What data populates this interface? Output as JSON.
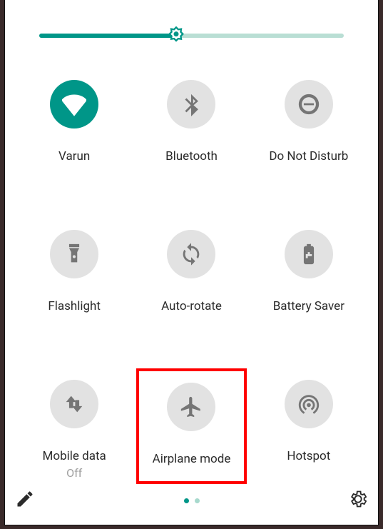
{
  "brightness": {
    "percent": 45
  },
  "tiles": [
    {
      "label": "Varun",
      "sublabel": ""
    },
    {
      "label": "Bluetooth",
      "sublabel": ""
    },
    {
      "label": "Do Not Disturb",
      "sublabel": ""
    },
    {
      "label": "Flashlight",
      "sublabel": ""
    },
    {
      "label": "Auto-rotate",
      "sublabel": ""
    },
    {
      "label": "Battery Saver",
      "sublabel": ""
    },
    {
      "label": "Mobile data",
      "sublabel": "Off"
    },
    {
      "label": "Airplane mode",
      "sublabel": ""
    },
    {
      "label": "Hotspot",
      "sublabel": ""
    }
  ],
  "pagination": {
    "current": 1,
    "total": 2
  },
  "colors": {
    "accent": "#009688",
    "inactive_bg": "#e2e2e2",
    "highlight": "#ff0000"
  }
}
